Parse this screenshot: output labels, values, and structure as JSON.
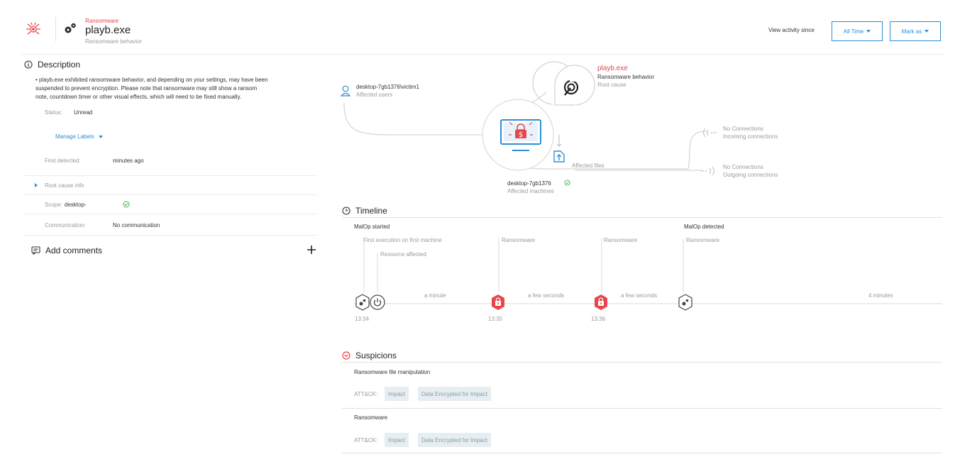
{
  "header": {
    "type_label": "Ransomware",
    "title": "playb.exe",
    "subtitle": "Ransomware behavior",
    "view_since_label": "View activity since",
    "time_button_label": "All Time",
    "mark_button_label": "Mark as",
    "accent_color": "#e8464a",
    "link_color": "#2d8fd6"
  },
  "description": {
    "title": "Description",
    "body_lines": [
      "• playb.exe exhibited ransomware behavior, and depending on your settings, may have been",
      "suspended to prevent encryption. Please note that ransomware may still show a ransom",
      "note, countdown timer or other visual effects, which will need to be fixed manually."
    ],
    "status_label": "Status:",
    "status_value": "Unread",
    "manage_labels": "Manage Labels",
    "first_detected_label": "First detected:",
    "first_detected_value": "minutes ago",
    "root_cause_label": "Root cause info",
    "scope_label": "Scope:",
    "scope_value": "desktop-",
    "communication_label": "Communication:",
    "communication_value": "No communication"
  },
  "comments": {
    "title": "Add comments"
  },
  "graph": {
    "user_name": "desktop-7gb1376\\victim1",
    "user_label": "Affected users",
    "root_name": "playb.exe",
    "root_behavior": "Ransomware behavior",
    "root_label": "Root cause",
    "files_label": "Affected files",
    "machine_name": "desktop-7gb1376",
    "machine_label": "Affected machines",
    "incoming_value": "No Connections",
    "incoming_label": "Incoming connections",
    "outgoing_value": "No Connections",
    "outgoing_label": "Outgoing connections"
  },
  "timeline": {
    "title": "Timeline",
    "header_left": "MalOp started",
    "header_right": "MalOp detected",
    "events": {
      "first_execution": "First execution on first machine",
      "resource_affected": "Resource affected",
      "ransomware_1": "Ransomware",
      "ransomware_2": "Ransomware",
      "ransomware_3": "Ransomware"
    },
    "gaps": [
      "a minute",
      "a few seconds",
      "a few seconds",
      "4 minutes"
    ],
    "times": [
      "13:34",
      "13:35",
      "13:36"
    ]
  },
  "suspicions": {
    "title": "Suspicions",
    "items": [
      {
        "name": "Ransomware file manipulation",
        "attck_label": "ATT&CK:",
        "tags": [
          "Impact",
          "Data Encrypted for Impact"
        ]
      },
      {
        "name": "Ransomware",
        "attck_label": "ATT&CK:",
        "tags": [
          "Impact",
          "Data Encrypted for Impact"
        ]
      }
    ]
  }
}
